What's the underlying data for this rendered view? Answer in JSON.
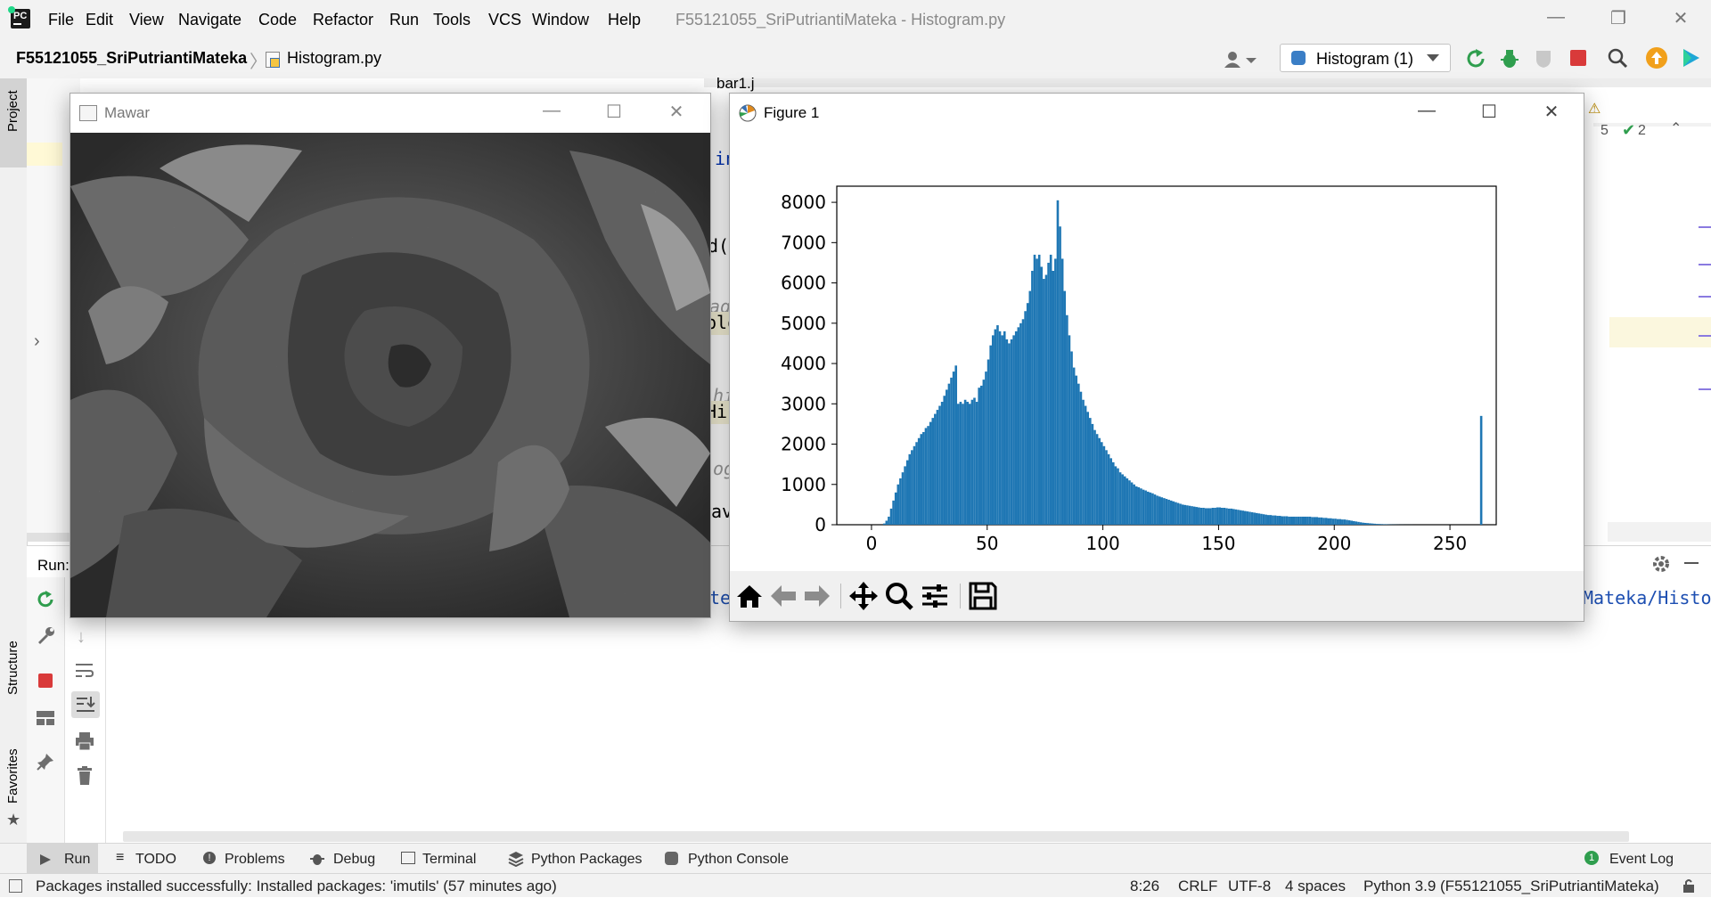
{
  "menubar": {
    "items": [
      "File",
      "Edit",
      "View",
      "Navigate",
      "Code",
      "Refactor",
      "Run",
      "Tools",
      "VCS",
      "Window",
      "Help"
    ],
    "title": "F55121055_SriPutriantiMateka - Histogram.py"
  },
  "navbar": {
    "project": "F55121055_SriPutriantiMateka",
    "file": "Histogram.py",
    "run_config": "Histogram (1)"
  },
  "sidebar": {
    "project_tab": "Project",
    "structure_tab": "Structure",
    "favorites_tab": "Favorites"
  },
  "editor": {
    "tab_partial": "bar1.j",
    "inspections_warn": "5",
    "inspections_ok": "2",
    "run_label": "Run:",
    "run_output_right": "Mateka/Histo",
    "run_output_left": "te"
  },
  "mawar_window": {
    "title": "Mawar"
  },
  "figure_window": {
    "title": "Figure 1"
  },
  "chart_data": {
    "type": "bar",
    "title": "",
    "xlabel": "",
    "ylabel": "",
    "xlim": [
      -15,
      270
    ],
    "ylim": [
      0,
      8400
    ],
    "xticks": [
      0,
      50,
      100,
      150,
      200,
      250
    ],
    "yticks": [
      0,
      1000,
      2000,
      3000,
      4000,
      5000,
      6000,
      7000,
      8000
    ],
    "color": "#1f77b4",
    "bins_start": 0,
    "bin_width": 1,
    "values": [
      0,
      0,
      0,
      0,
      0,
      30,
      100,
      200,
      400,
      600,
      800,
      1000,
      1150,
      1300,
      1450,
      1600,
      1750,
      1850,
      1950,
      2050,
      2150,
      2250,
      2300,
      2400,
      2450,
      2550,
      2650,
      2750,
      2850,
      2950,
      3050,
      3200,
      3350,
      3500,
      3650,
      3800,
      3950,
      3000,
      3050,
      3000,
      3100,
      3050,
      3000,
      3100,
      3150,
      3050,
      3400,
      3450,
      3600,
      3800,
      4100,
      4450,
      4700,
      4850,
      4950,
      4800,
      4700,
      4800,
      4600,
      4500,
      4600,
      4700,
      4800,
      4900,
      5000,
      5100,
      5300,
      5500,
      5800,
      6300,
      6700,
      6600,
      6700,
      6400,
      6100,
      6200,
      6500,
      6700,
      6300,
      6600,
      8050,
      7400,
      6600,
      5800,
      5200,
      4700,
      4300,
      3900,
      3700,
      3500,
      3300,
      3100,
      2950,
      2800,
      2650,
      2500,
      2350,
      2250,
      2150,
      2050,
      1950,
      1850,
      1750,
      1650,
      1550,
      1450,
      1400,
      1300,
      1250,
      1200,
      1150,
      1100,
      1050,
      1000,
      950,
      930,
      900,
      870,
      850,
      820,
      800,
      780,
      750,
      720,
      700,
      680,
      660,
      640,
      620,
      600,
      580,
      560,
      540,
      520,
      500,
      490,
      480,
      470,
      460,
      450,
      440,
      430,
      420,
      420,
      410,
      410,
      410,
      420,
      420,
      430,
      430,
      420,
      420,
      410,
      400,
      400,
      390,
      380,
      370,
      360,
      350,
      340,
      330,
      320,
      310,
      300,
      290,
      280,
      270,
      260,
      250,
      240,
      240,
      230,
      230,
      220,
      220,
      210,
      210,
      210,
      200,
      200,
      200,
      200,
      200,
      200,
      200,
      200,
      200,
      200,
      190,
      190,
      190,
      180,
      180,
      170,
      170,
      160,
      160,
      150,
      150,
      140,
      140,
      130,
      130,
      120,
      110,
      100,
      90,
      80,
      70,
      60,
      50,
      45,
      40,
      35,
      30,
      25,
      20,
      18,
      15,
      12,
      10,
      8,
      6,
      5,
      4,
      3,
      2,
      2,
      1,
      1,
      1,
      1,
      0,
      0,
      0,
      0,
      0,
      0,
      0,
      0,
      0,
      0,
      0,
      0,
      0,
      0,
      0,
      0,
      0,
      0,
      0,
      0,
      0,
      0,
      0,
      0,
      0,
      0,
      0,
      0,
      0,
      2700
    ]
  },
  "bottom_tabs": [
    "Run",
    "TODO",
    "Problems",
    "Debug",
    "Terminal",
    "Python Packages",
    "Python Console"
  ],
  "event_log": "Event Log",
  "status": {
    "message": "Packages installed successfully: Installed packages: 'imutils' (57 minutes ago)",
    "position": "8:26",
    "line_sep": "CRLF",
    "encoding": "UTF-8",
    "indent": "4 spaces",
    "interpreter": "Python 3.9 (F55121055_SriPutriantiMateka)"
  }
}
